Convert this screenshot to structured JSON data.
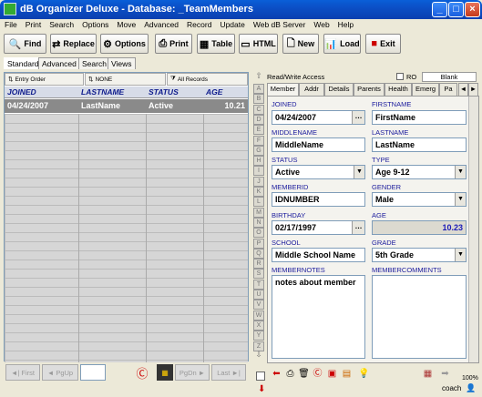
{
  "window": {
    "title": "dB Organizer Deluxe - Database: _TeamMembers",
    "minimize": "_",
    "maximize": "□",
    "close": "×"
  },
  "menu": [
    "File",
    "Print",
    "Search",
    "Options",
    "Move",
    "Advanced",
    "Record",
    "Update",
    "Web dB Server",
    "Web",
    "Help"
  ],
  "toolbar": {
    "find": "Find",
    "replace": "Replace",
    "options": "Options",
    "print": "Print",
    "table": "Table",
    "html": "HTML",
    "new": "New",
    "load": "Load",
    "exit": "Exit"
  },
  "modes": [
    "Standard",
    "Advanced",
    "Search",
    "Views"
  ],
  "sort": {
    "entry": "Entry Order",
    "none": "NONE",
    "all": "All Records"
  },
  "grid": {
    "headers": [
      "JOINED",
      "LASTNAME",
      "STATUS",
      "AGE"
    ],
    "row": [
      "04/24/2007",
      "LastName",
      "Active",
      "10.21"
    ]
  },
  "nav": {
    "first": "First",
    "pgup": "PgUp",
    "pgdn": "PgDn",
    "last": "Last"
  },
  "alpha": [
    "A",
    "B",
    "C",
    "D",
    "E",
    "F",
    "G",
    "H",
    "I",
    "J",
    "K",
    "L",
    "M",
    "N",
    "O",
    "P",
    "Q",
    "R",
    "S",
    "T",
    "U",
    "V",
    "W",
    "X",
    "Y",
    "Z"
  ],
  "access": {
    "text": "Read/Write Access",
    "ro": "RO",
    "blank": "Blank"
  },
  "tabs": [
    "Member",
    "Addr",
    "Details",
    "Parents",
    "Health",
    "Emerg",
    "Pa"
  ],
  "form": {
    "joined_label": "JOINED",
    "joined": "04/24/2007",
    "firstname_label": "FIRSTNAME",
    "firstname": "FirstName",
    "middlename_label": "MIDDLENAME",
    "middlename": "MiddleName",
    "lastname_label": "LASTNAME",
    "lastname": "LastName",
    "status_label": "STATUS",
    "status": "Active",
    "type_label": "TYPE",
    "type": "Age 9-12",
    "memberid_label": "MEMBERID",
    "memberid": "IDNUMBER",
    "gender_label": "GENDER",
    "gender": "Male",
    "birthday_label": "BIRTHDAY",
    "birthday": "02/17/1997",
    "age_label": "AGE",
    "age": "10.23",
    "school_label": "SCHOOL",
    "school": "Middle School Name",
    "grade_label": "GRADE",
    "grade": "5th Grade",
    "notes_label": "MEMBERNOTES",
    "notes": "notes about member",
    "comments_label": "MEMBERCOMMENTS",
    "comments": ""
  },
  "status": {
    "zoom": "100%",
    "user": "coach"
  },
  "colors": {
    "accent": "#0a5fd8",
    "ageText": "#1a1ab8"
  }
}
